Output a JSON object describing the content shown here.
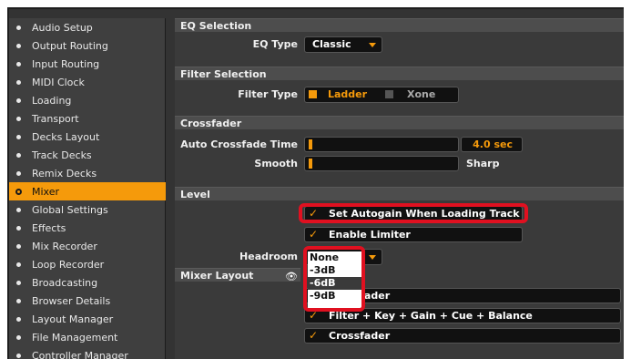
{
  "sidebar": {
    "items": [
      {
        "label": "Audio Setup",
        "active": false
      },
      {
        "label": "Output Routing",
        "active": false
      },
      {
        "label": "Input Routing",
        "active": false
      },
      {
        "label": "MIDI Clock",
        "active": false
      },
      {
        "label": "Loading",
        "active": false
      },
      {
        "label": "Transport",
        "active": false
      },
      {
        "label": "Decks Layout",
        "active": false
      },
      {
        "label": "Track Decks",
        "active": false
      },
      {
        "label": "Remix Decks",
        "active": false
      },
      {
        "label": "Mixer",
        "active": true
      },
      {
        "label": "Global Settings",
        "active": false
      },
      {
        "label": "Effects",
        "active": false
      },
      {
        "label": "Mix Recorder",
        "active": false
      },
      {
        "label": "Loop Recorder",
        "active": false
      },
      {
        "label": "Broadcasting",
        "active": false
      },
      {
        "label": "Browser Details",
        "active": false
      },
      {
        "label": "Layout Manager",
        "active": false
      },
      {
        "label": "File Management",
        "active": false
      },
      {
        "label": "Controller Manager",
        "active": false
      }
    ]
  },
  "eq_selection": {
    "header": "EQ Selection",
    "eq_type_label": "EQ Type",
    "eq_type_value": "Classic"
  },
  "filter_selection": {
    "header": "Filter Selection",
    "filter_type_label": "Filter Type",
    "option_ladder": "Ladder",
    "option_xone": "Xone",
    "selected": "Ladder"
  },
  "crossfader": {
    "header": "Crossfader",
    "auto_time_label": "Auto Crossfade Time",
    "auto_time_value": "4.0 sec",
    "auto_time_level": 0.02,
    "smooth_label": "Smooth",
    "sharp_label": "Sharp",
    "curve_level": 0.02
  },
  "level": {
    "header": "Level",
    "autogain_label": "Set Autogain When Loading Track",
    "autogain_checked": true,
    "limiter_label": "Enable Limiter",
    "limiter_checked": true,
    "headroom_label": "Headroom",
    "headroom_options": [
      "None",
      "-3dB",
      "-6dB",
      "-9dB"
    ],
    "headroom_selected": "-6dB"
  },
  "mixer_layout": {
    "header": "Mixer Layout",
    "row1_label": "Crossfader",
    "row2_label": "Filter + Key + Gain + Cue + Balance",
    "row3_label": "Crossfader"
  },
  "colors": {
    "accent": "#f59a0b",
    "highlight_outline": "#e01020"
  }
}
